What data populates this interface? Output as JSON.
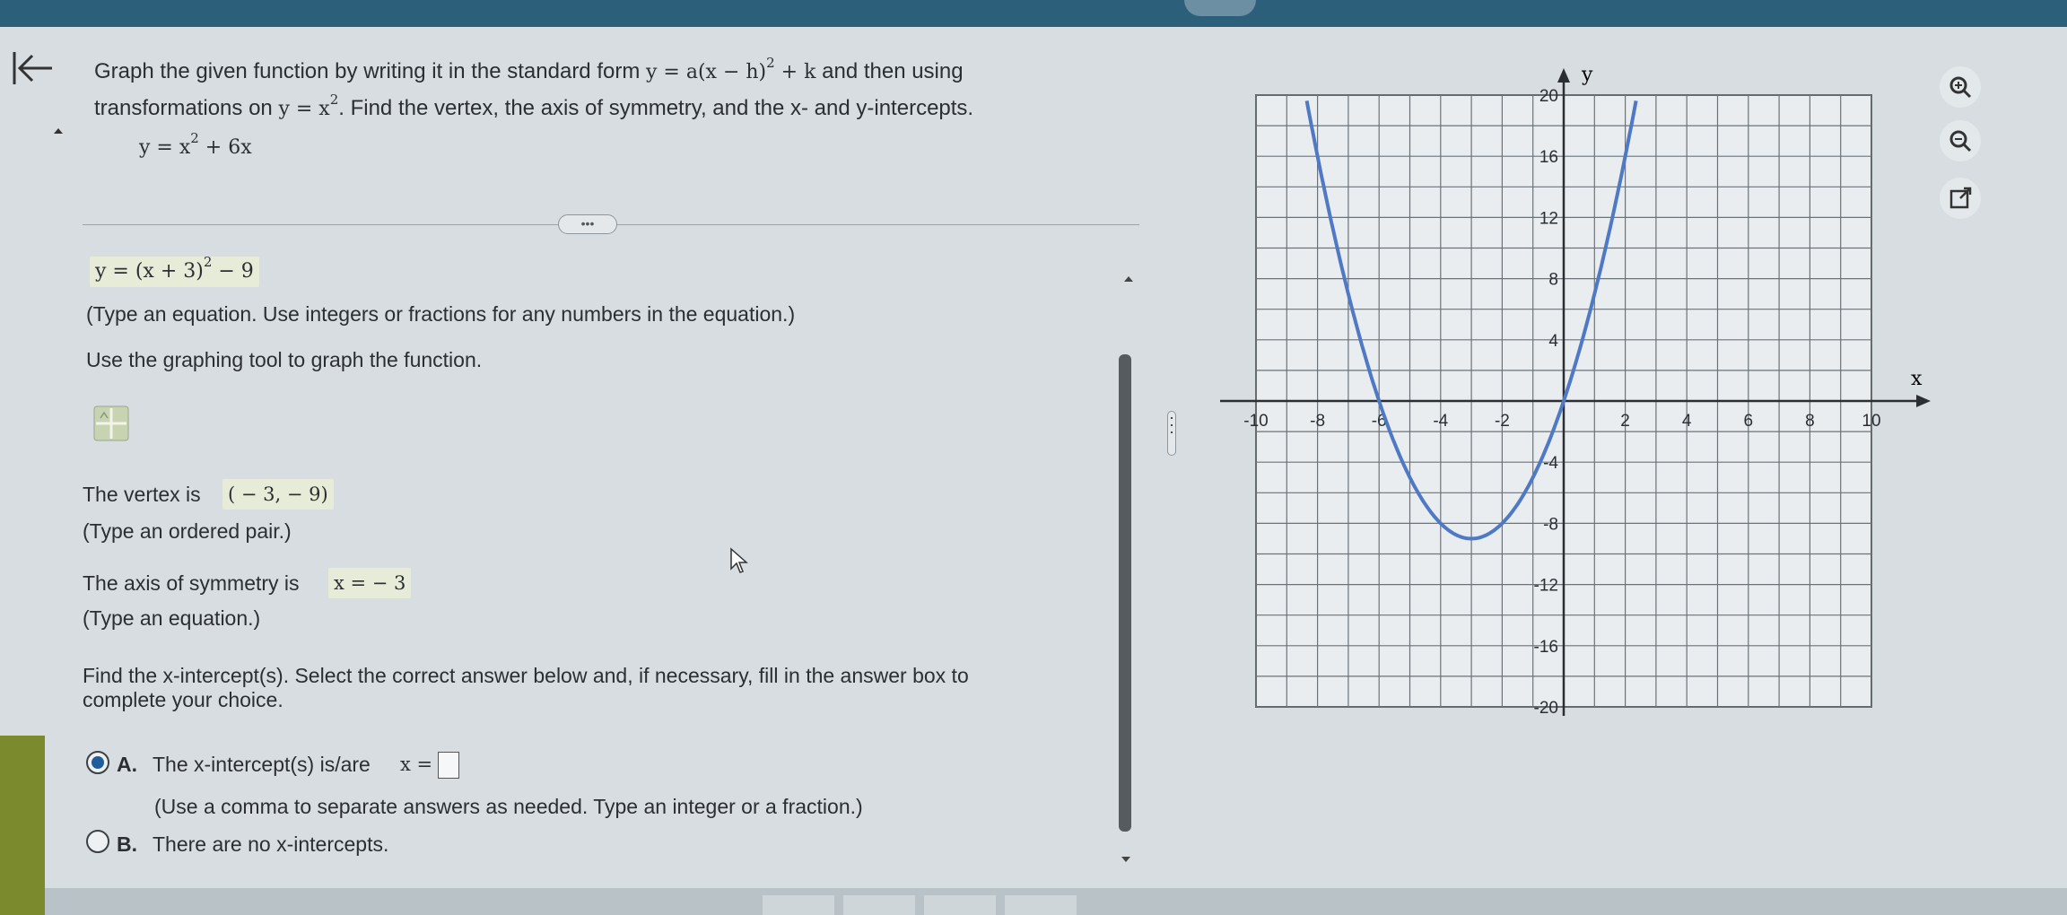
{
  "question": {
    "line1_pre": "Graph the given function by writing it in the standard form ",
    "standard_form": "y = a(x − h)",
    "standard_form_exp": "2",
    "standard_form_tail": " + k",
    "line1_post": " and then using",
    "line2_pre": "transformations on ",
    "base_fn": "y = x",
    "base_fn_exp": "2",
    "line2_post": ". Find the vertex, the axis of symmetry, and the x- and y-intercepts.",
    "given_eq_pre": "y = x",
    "given_eq_exp": "2",
    "given_eq_post": " + 6x"
  },
  "more_button": "•••",
  "standard_form_answer": {
    "pre": "y = (x + 3)",
    "exp": "2",
    "post": " − 9",
    "hint": "(Type an equation. Use integers or fractions for any numbers in the equation.)"
  },
  "graph_instruction": "Use the graphing tool to graph the function.",
  "vertex": {
    "label": "The vertex is",
    "value": "( − 3, − 9)",
    "hint": "(Type an ordered pair.)"
  },
  "axis": {
    "label": "The axis of symmetry is",
    "value": "x = − 3",
    "hint": "(Type an equation.)"
  },
  "xintercept": {
    "prompt_line1": "Find the x-intercept(s). Select the correct answer below and, if necessary, fill in the answer box to",
    "prompt_line2": "complete your choice.",
    "option_a_letter": "A.",
    "option_a_text": "The x-intercept(s) is/are ",
    "option_a_var": "x =",
    "option_a_hint": "(Use a comma to separate answers as needed. Type an integer or a fraction.)",
    "option_b_letter": "B.",
    "option_b_text": "There are no x-intercepts.",
    "selected": "A"
  },
  "graph": {
    "x_axis_label": "x",
    "y_axis_label": "y",
    "x_ticks": [
      "-10",
      "-8",
      "-6",
      "-4",
      "-2",
      "2",
      "4",
      "6",
      "8",
      "10"
    ],
    "y_ticks": [
      "20",
      "16",
      "12",
      "8",
      "4",
      "-4",
      "-8",
      "-12",
      "-16",
      "-20"
    ],
    "xlim": [
      -10,
      10
    ],
    "ylim": [
      -20,
      20
    ],
    "curve_color": "#4f79c4",
    "function": "y = x^2 + 6x"
  },
  "tools": [
    "zoom-in-icon",
    "zoom-out-icon",
    "expand-icon"
  ]
}
